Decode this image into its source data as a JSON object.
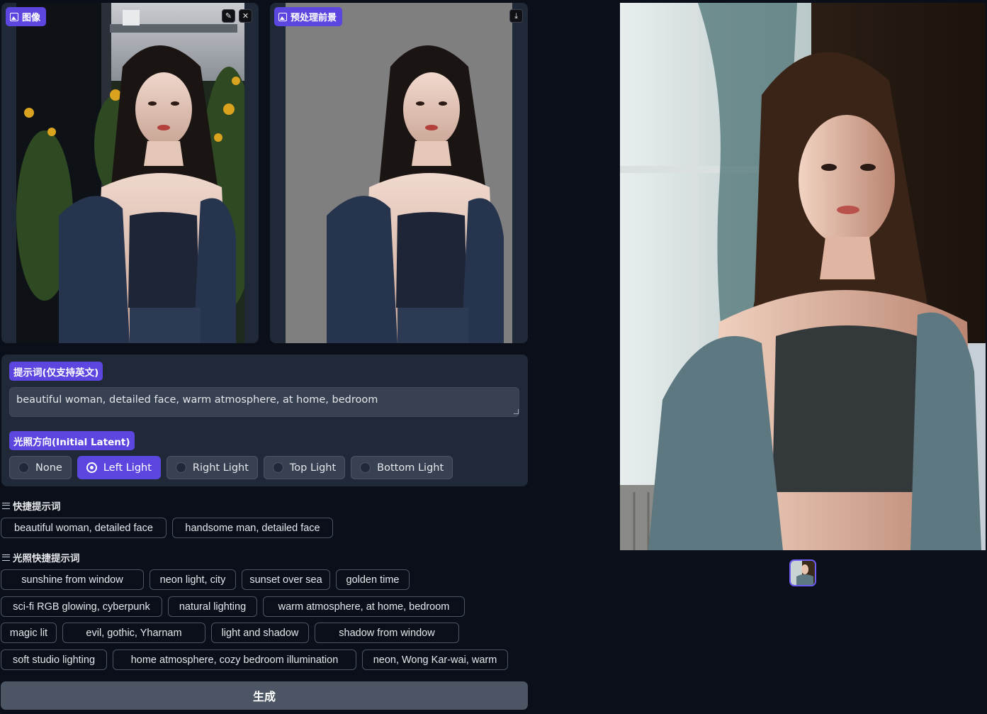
{
  "input_panel": {
    "label": "图像",
    "edit_icon": "pencil-icon",
    "close_icon": "close-icon"
  },
  "foreground_panel": {
    "label": "预处理前景",
    "download_icon": "download-icon"
  },
  "prompt": {
    "label": "提示词(仅支持英文)",
    "value": "beautiful woman, detailed face, warm atmosphere, at home, bedroom"
  },
  "light_direction": {
    "label": "光照方向(Initial Latent)",
    "options": [
      "None",
      "Left Light",
      "Right Light",
      "Top Light",
      "Bottom Light"
    ],
    "selected": "Left Light"
  },
  "quick_prompts": {
    "title": "快捷提示词",
    "items": [
      "beautiful woman, detailed face",
      "handsome man, detailed face"
    ]
  },
  "light_quick_prompts": {
    "title": "光照快捷提示词",
    "rows": [
      [
        "sunshine from window",
        "neon light, city",
        "sunset over sea",
        "golden time"
      ],
      [
        "sci-fi RGB glowing, cyberpunk",
        "natural lighting",
        "warm atmosphere, at home, bedroom"
      ],
      [
        "magic lit",
        "evil, gothic, Yharnam",
        "light and shadow",
        "shadow from window"
      ],
      [
        "soft studio lighting",
        "home atmosphere, cozy bedroom illumination",
        "neon, Wong Kar-wai, warm"
      ]
    ]
  },
  "generate_label": "生成",
  "colors": {
    "accent": "#5b47e0",
    "panel": "#1f2937",
    "background": "#0b0f19"
  }
}
